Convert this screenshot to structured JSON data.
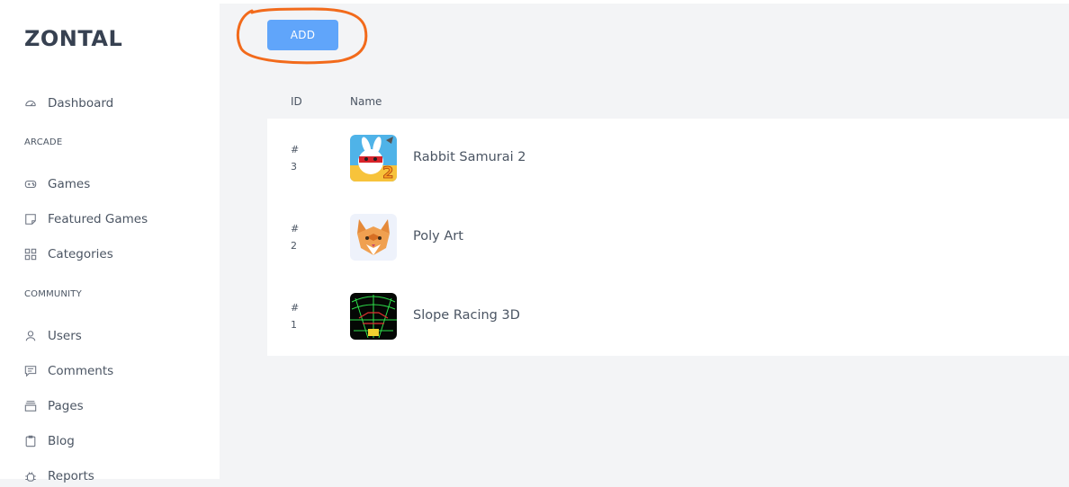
{
  "app": {
    "brand": "ZONTAL"
  },
  "sidebar": {
    "dashboard": "Dashboard",
    "section_arcade": "ARCADE",
    "games": "Games",
    "featured_games": "Featured Games",
    "categories": "Categories",
    "section_community": "COMMUNITY",
    "users": "Users",
    "comments": "Comments",
    "pages": "Pages",
    "blog": "Blog",
    "reports": "Reports"
  },
  "toolbar": {
    "add_label": "ADD"
  },
  "table": {
    "columns": {
      "id": "ID",
      "name": "Name"
    },
    "rows": [
      {
        "hash": "#",
        "id": "3",
        "name": "Rabbit Samurai 2",
        "thumb_icon": "rabbit-samurai-thumbnail"
      },
      {
        "hash": "#",
        "id": "2",
        "name": "Poly Art",
        "thumb_icon": "poly-art-cat-thumbnail"
      },
      {
        "hash": "#",
        "id": "1",
        "name": "Slope Racing 3D",
        "thumb_icon": "slope-racing-thumbnail"
      }
    ]
  },
  "colors": {
    "accent": "#60a5fa",
    "annotation": "#f26a1b",
    "sidebar_text": "#4b5563",
    "background": "#f3f4f6"
  }
}
